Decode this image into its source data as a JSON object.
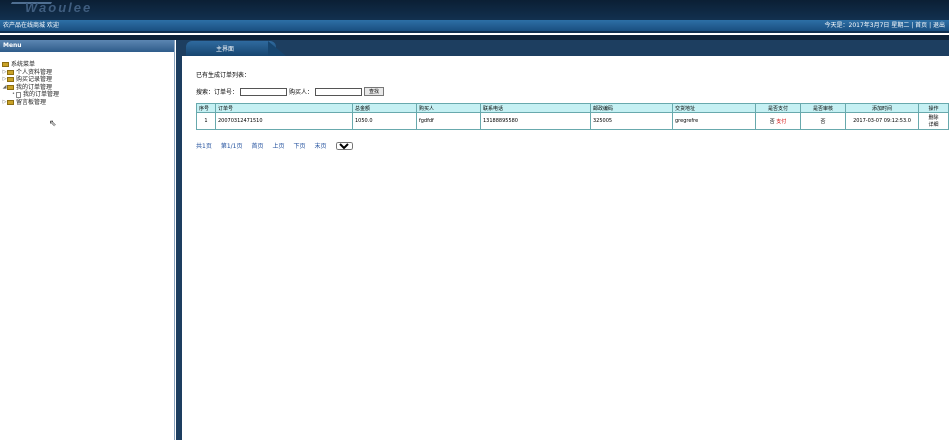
{
  "header": {
    "logo_text": "Waoulee"
  },
  "topbar": {
    "left_text": "农产品在线商城 欢迎",
    "right_text": "今天是：2017年3月7日 星期二 | 首页 | 退出"
  },
  "sidebar": {
    "title": "Menu",
    "root": "系统菜单",
    "items": [
      {
        "label": "个人资料管理"
      },
      {
        "label": "购买记录管理"
      },
      {
        "label": "我的订单管理",
        "children": [
          "我的订单管理"
        ]
      },
      {
        "label": "留言板管理"
      }
    ]
  },
  "tab": {
    "label": "主界面"
  },
  "main": {
    "title": "已有生成订单列表：",
    "search": {
      "label": "搜索：订单号：",
      "buyer_label": "购买人：",
      "button": "查找"
    },
    "table": {
      "headers": [
        "序号",
        "订单号",
        "总金额",
        "购买人",
        "联系电话",
        "邮政编码",
        "交货地址",
        "是否支付",
        "是否审核",
        "添加时间",
        "操作"
      ],
      "rows": [
        {
          "no": "1",
          "order": "20070312471510",
          "amount": "1050.0",
          "buyer": "fgdfdf",
          "phone": "13188895580",
          "zip": "325005",
          "address": "gregrefre",
          "paid": "否",
          "pay_action": "支付",
          "audited": "否",
          "time": "2017-03-07 09:12:53.0",
          "ops": [
            "删除",
            "详细"
          ]
        }
      ]
    },
    "pager": {
      "total": "共1页",
      "current": "第1/1页",
      "first": "首页",
      "prev": "上页",
      "next": "下页",
      "last": "末页",
      "select_value": "1"
    }
  }
}
